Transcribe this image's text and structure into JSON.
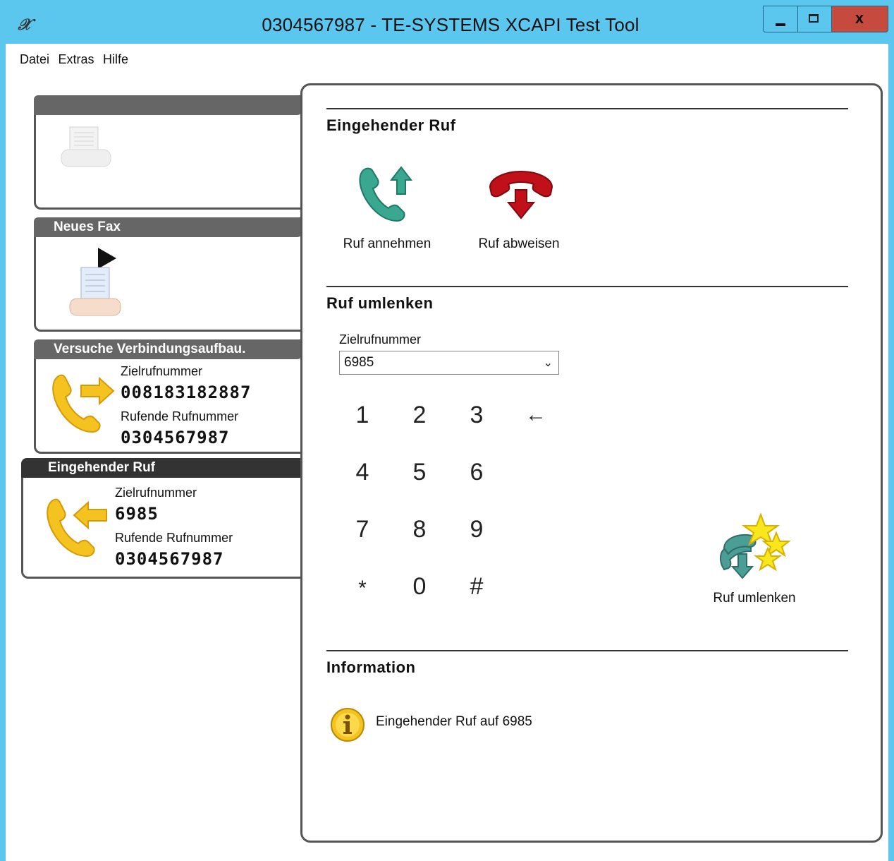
{
  "window": {
    "title": "0304567987 - TE-SYSTEMS XCAPI Test Tool",
    "icon": "xcapi-logo-icon",
    "controls": {
      "minimize": "minimize",
      "maximize": "maximize",
      "close": "x"
    }
  },
  "menu": {
    "items": [
      "Datei",
      "Extras",
      "Hilfe"
    ]
  },
  "sidebar": {
    "fax_empty": {
      "title": ""
    },
    "new_fax": {
      "title": "Neues Fax"
    },
    "outgoing": {
      "title": "Versuche Verbindungsaufbau.",
      "target_label": "Zielrufnummer",
      "target_value": "008183182887",
      "caller_label": "Rufende Rufnummer",
      "caller_value": "0304567987"
    },
    "incoming": {
      "title": "Eingehender Ruf",
      "target_label": "Zielrufnummer",
      "target_value": "6985",
      "caller_label": "Rufende Rufnummer",
      "caller_value": "0304567987"
    }
  },
  "main": {
    "incoming_section": {
      "title": "Eingehender Ruf",
      "accept_label": "Ruf annehmen",
      "reject_label": "Ruf abweisen"
    },
    "redirect_section": {
      "title": "Ruf umlenken",
      "field_label": "Zielrufnummer",
      "field_value": "6985",
      "keys": [
        "1",
        "2",
        "3",
        "4",
        "5",
        "6",
        "7",
        "8",
        "9",
        "*",
        "0",
        "#"
      ],
      "backspace": "←",
      "redirect_label": "Ruf umlenken"
    },
    "info_section": {
      "title": "Information",
      "message": "Eingehender Ruf auf 6985"
    }
  },
  "colors": {
    "titlebar": "#5bc7ee",
    "accept_green": "#3aa890",
    "reject_red": "#c0101a",
    "call_yellow": "#f5c31f"
  }
}
